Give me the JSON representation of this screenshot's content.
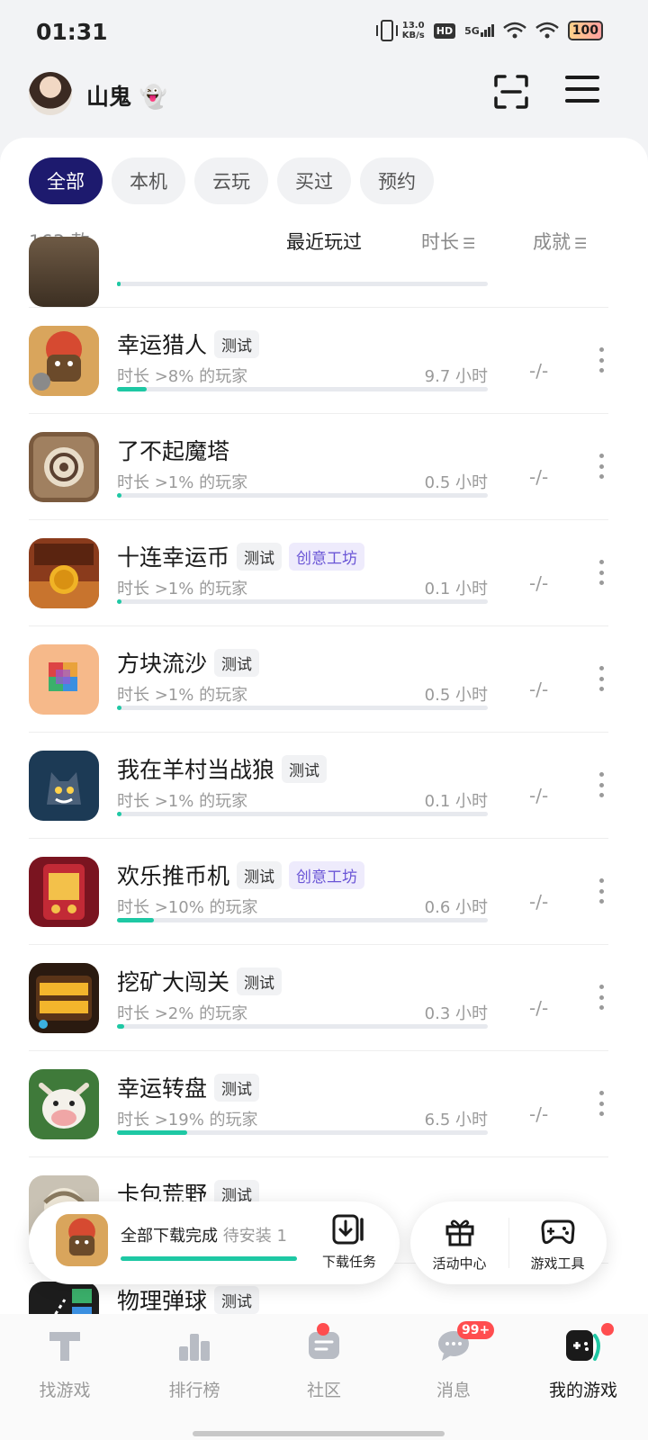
{
  "status_bar": {
    "time": "01:31",
    "net_speed_top": "13.0",
    "net_speed_bottom": "KB/s",
    "hd": "HD",
    "network": "5G",
    "battery": "100"
  },
  "header": {
    "username": "山鬼",
    "ghost_emoji": "👻"
  },
  "filters": [
    {
      "label": "全部",
      "active": true
    },
    {
      "label": "本机",
      "active": false
    },
    {
      "label": "云玩",
      "active": false
    },
    {
      "label": "买过",
      "active": false
    },
    {
      "label": "预约",
      "active": false
    }
  ],
  "sort": {
    "count": "163 款",
    "recent": "最近玩过",
    "duration": "时长",
    "achievement": "成就",
    "sort_glyph": "☰"
  },
  "games": [
    {
      "title": "幸运猎人",
      "tags": [
        "测试"
      ],
      "sub": "时长 >8% 的玩家",
      "hours": "9.7 小时",
      "ach": "-/-",
      "progress": 0.08
    },
    {
      "title": "了不起魔塔",
      "tags": [],
      "sub": "时长 >1% 的玩家",
      "hours": "0.5 小时",
      "ach": "-/-",
      "progress": 0.01
    },
    {
      "title": "十连幸运币",
      "tags": [
        "测试"
      ],
      "workshop": "创意工坊",
      "sub": "时长 >1% 的玩家",
      "hours": "0.1 小时",
      "ach": "-/-",
      "progress": 0.01
    },
    {
      "title": "方块流沙",
      "tags": [
        "测试"
      ],
      "sub": "时长 >1% 的玩家",
      "hours": "0.5 小时",
      "ach": "-/-",
      "progress": 0.01
    },
    {
      "title": "我在羊村当战狼",
      "tags": [
        "测试"
      ],
      "sub": "时长 >1% 的玩家",
      "hours": "0.1 小时",
      "ach": "-/-",
      "progress": 0.01
    },
    {
      "title": "欢乐推币机",
      "tags": [
        "测试"
      ],
      "workshop": "创意工坊",
      "sub": "时长 >10% 的玩家",
      "hours": "0.6 小时",
      "ach": "-/-",
      "progress": 0.1
    },
    {
      "title": "挖矿大闯关",
      "tags": [
        "测试"
      ],
      "sub": "时长 >2% 的玩家",
      "hours": "0.3 小时",
      "ach": "-/-",
      "progress": 0.02
    },
    {
      "title": "幸运转盘",
      "tags": [
        "测试"
      ],
      "sub": "时长 >19% 的玩家",
      "hours": "6.5 小时",
      "ach": "-/-",
      "progress": 0.19
    },
    {
      "title": "卡包荒野",
      "tags": [
        "测试"
      ]
    },
    {
      "title": "物理弹球",
      "tags": [
        "测试"
      ]
    }
  ],
  "download": {
    "text": "全部下载完成",
    "pending": "待安装 1",
    "task_label": "下载任务",
    "progress": 1.0
  },
  "tools": {
    "activity": "活动中心",
    "game_tools": "游戏工具"
  },
  "tabs": [
    {
      "label": "找游戏",
      "icon": "find-game-icon"
    },
    {
      "label": "排行榜",
      "icon": "ranking-icon"
    },
    {
      "label": "社区",
      "icon": "community-icon"
    },
    {
      "label": "消息",
      "icon": "message-icon",
      "badge": "99+"
    },
    {
      "label": "我的游戏",
      "icon": "my-games-icon"
    }
  ],
  "colors": {
    "accent": "#1d1a6e",
    "progress": "#1ec8a4",
    "workshop": "#6a55d6",
    "badge": "#ff4d4f"
  }
}
